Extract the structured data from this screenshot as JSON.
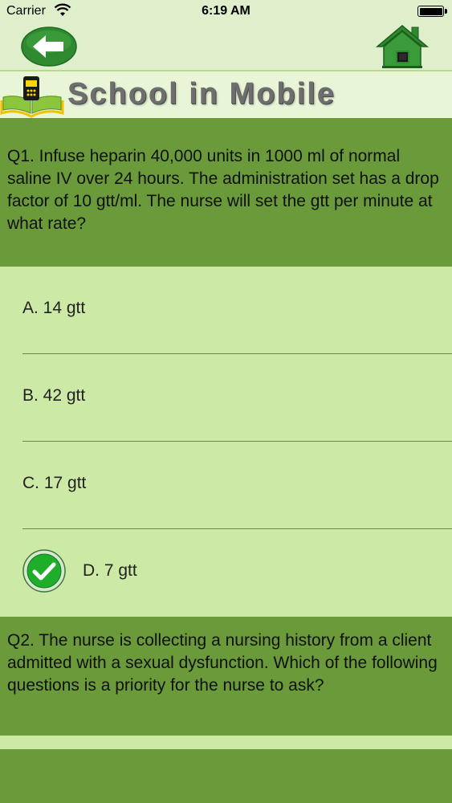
{
  "status_bar": {
    "carrier": "Carrier",
    "time": "6:19 AM"
  },
  "header": {
    "app_title": "School in Mobile"
  },
  "questions": [
    {
      "text": "Q1. Infuse heparin 40,000 units in 1000 ml of normal saline IV over 24 hours. The administration set has a drop factor of 10 gtt/ml. The nurse will set the gtt per minute at what rate?",
      "options": [
        "A. 14 gtt",
        "B. 42 gtt",
        "C. 17 gtt",
        "D. 7 gtt"
      ],
      "selected_index": 3
    },
    {
      "text": "Q2. The nurse is collecting a nursing history from a client admitted with a sexual dysfunction. Which of the following questions is a priority for the nurse to ask?"
    }
  ],
  "colors": {
    "header_green": "#6a9a3a",
    "option_bg": "#cce9a6",
    "topbar_bg": "#dfeecb",
    "accent_green": "#2e8b2e"
  }
}
